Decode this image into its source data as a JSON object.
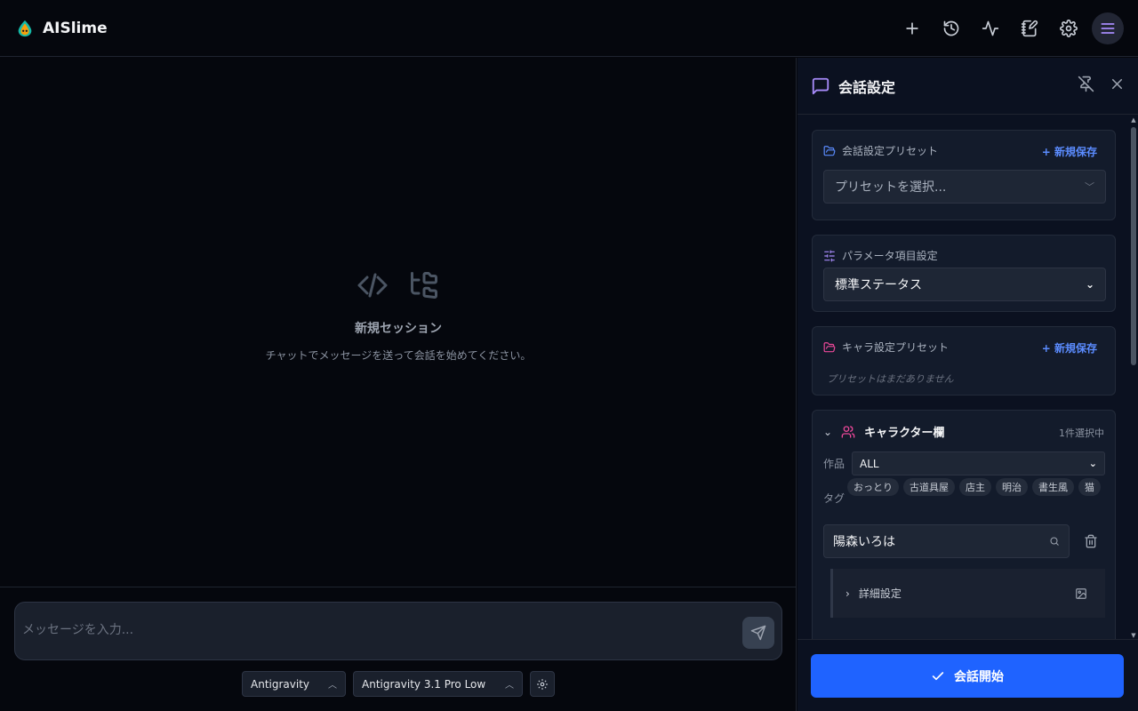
{
  "app": {
    "name": "AISlime"
  },
  "topbar": {
    "actions": [
      {
        "name": "new-session",
        "icon": "plus-icon"
      },
      {
        "name": "history",
        "icon": "history-icon"
      },
      {
        "name": "activity",
        "icon": "activity-icon"
      },
      {
        "name": "notebook",
        "icon": "notebook-pen-icon"
      },
      {
        "name": "settings",
        "icon": "gear-icon"
      },
      {
        "name": "menu",
        "icon": "menu-icon",
        "active": true
      }
    ]
  },
  "main": {
    "empty_title": "新規セッション",
    "empty_subtitle": "チャットでメッセージを送って会話を始めてください。",
    "composer_placeholder": "メッセージを入力...",
    "provider": "Antigravity",
    "model": "Antigravity 3.1 Pro Low"
  },
  "panel": {
    "title": "会話設定",
    "conversation_preset": {
      "label": "会話設定プリセット",
      "action": "+ 新規保存",
      "placeholder": "プリセットを選択..."
    },
    "parameter": {
      "label": "パラメータ項目設定",
      "value": "標準ステータス"
    },
    "character_preset": {
      "label": "キャラ設定プリセット",
      "action": "+ 新規保存",
      "empty": "プリセットはまだありません"
    },
    "character": {
      "title": "キャラクター欄",
      "count": "1件選択中",
      "work_label": "作品",
      "work_value": "ALL",
      "tag_label": "タグ",
      "tags": [
        "おっとり",
        "古道具屋",
        "店主",
        "明治",
        "書生風",
        "猫"
      ],
      "name": "陽森いろは",
      "detail_label": "詳細設定"
    },
    "start_button": "会話開始"
  },
  "colors": {
    "accent_purple": "#a78bfa",
    "link_blue": "#5b8cff",
    "primary_button": "#1f63ff",
    "background": "#05070d",
    "panel_bg": "#0b1120"
  }
}
